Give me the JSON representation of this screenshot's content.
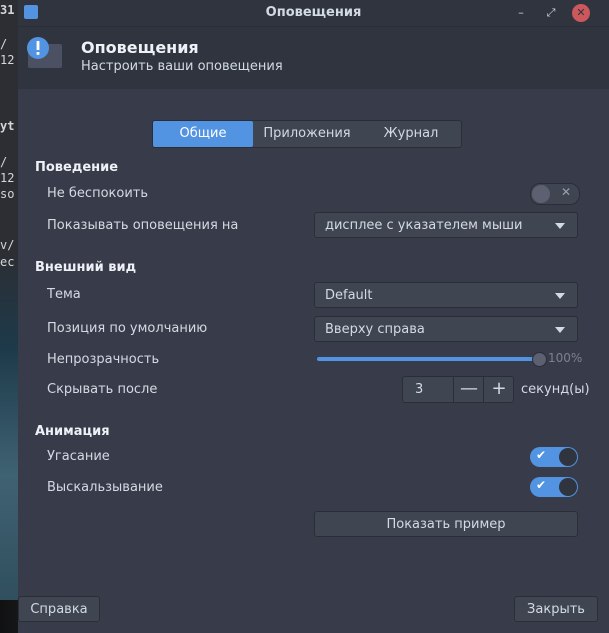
{
  "background": {
    "left_text": [
      "31",
      "/",
      "12",
      "yt",
      "/",
      "12",
      "so",
      "v/",
      "ec"
    ]
  },
  "window": {
    "title": "Оповещения",
    "minimize_glyph": "–",
    "maximize_glyph": "⤢",
    "close_glyph": "✕"
  },
  "header": {
    "title": "Оповещения",
    "subtitle": "Настроить ваши оповещения"
  },
  "tabs": [
    {
      "label": "Общие",
      "active": true
    },
    {
      "label": "Приложения",
      "active": false
    },
    {
      "label": "Журнал",
      "active": false
    }
  ],
  "behavior": {
    "heading": "Поведение",
    "dnd_label": "Не беспокоить",
    "dnd_on": false,
    "dnd_glyph": "✕",
    "show_on_label": "Показывать оповещения на",
    "show_on_value": "дисплее с указателем мыши"
  },
  "appearance": {
    "heading": "Внешний вид",
    "theme_label": "Тема",
    "theme_value": "Default",
    "position_label": "Позиция по умолчанию",
    "position_value": "Вверху справа",
    "opacity_label": "Непрозрачность",
    "opacity_value": "100%",
    "opacity_level": 1.0,
    "hide_after_label": "Скрывать после",
    "hide_after_value": "3",
    "hide_after_minus": "—",
    "hide_after_plus": "+",
    "hide_after_unit": "секунд(ы)"
  },
  "animation": {
    "heading": "Анимация",
    "fade_label": "Угасание",
    "fade_on": true,
    "slide_label": "Выскальзывание",
    "slide_on": true,
    "check_glyph": "✔"
  },
  "preview_button": "Показать пример",
  "footer": {
    "help_button": "Справка",
    "close_button": "Закрыть"
  },
  "colors": {
    "accent": "#5294e2",
    "window_bg": "#383c4a",
    "header_bg": "#2f343f",
    "close_button": "#cc575d"
  }
}
